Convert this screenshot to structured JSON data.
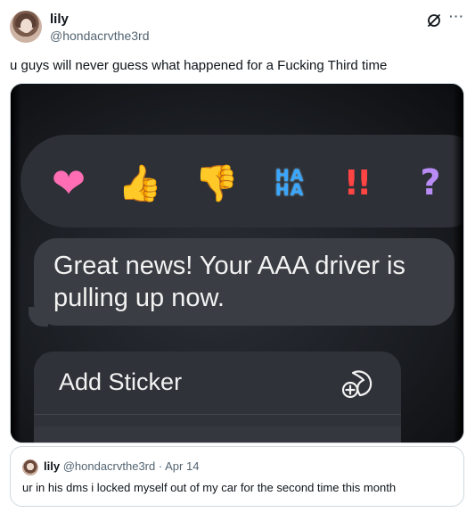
{
  "tweet": {
    "author_name": "lily",
    "author_handle": "@hondacrvthe3rd",
    "text": "u guys will never guess what happened for a Fucking Third time",
    "more_label": "···"
  },
  "media": {
    "reactions": [
      {
        "name": "heart",
        "glyph": "❤"
      },
      {
        "name": "thumbs-up",
        "glyph": "👍"
      },
      {
        "name": "thumbs-down",
        "glyph": "👎"
      },
      {
        "name": "haha",
        "line1": "HA",
        "line2": "HA"
      },
      {
        "name": "exclamation",
        "glyph": "!!"
      },
      {
        "name": "question",
        "glyph": "?"
      }
    ],
    "message_text": "Great news! Your AAA driver is pulling up now.",
    "menu_item": "Add Sticker"
  },
  "quoted_tweet": {
    "author_name": "lily",
    "author_handle": "@hondacrvthe3rd",
    "separator": "·",
    "date": "Apr 14",
    "text": "ur in his dms i locked myself out of my car for the second time this month"
  }
}
